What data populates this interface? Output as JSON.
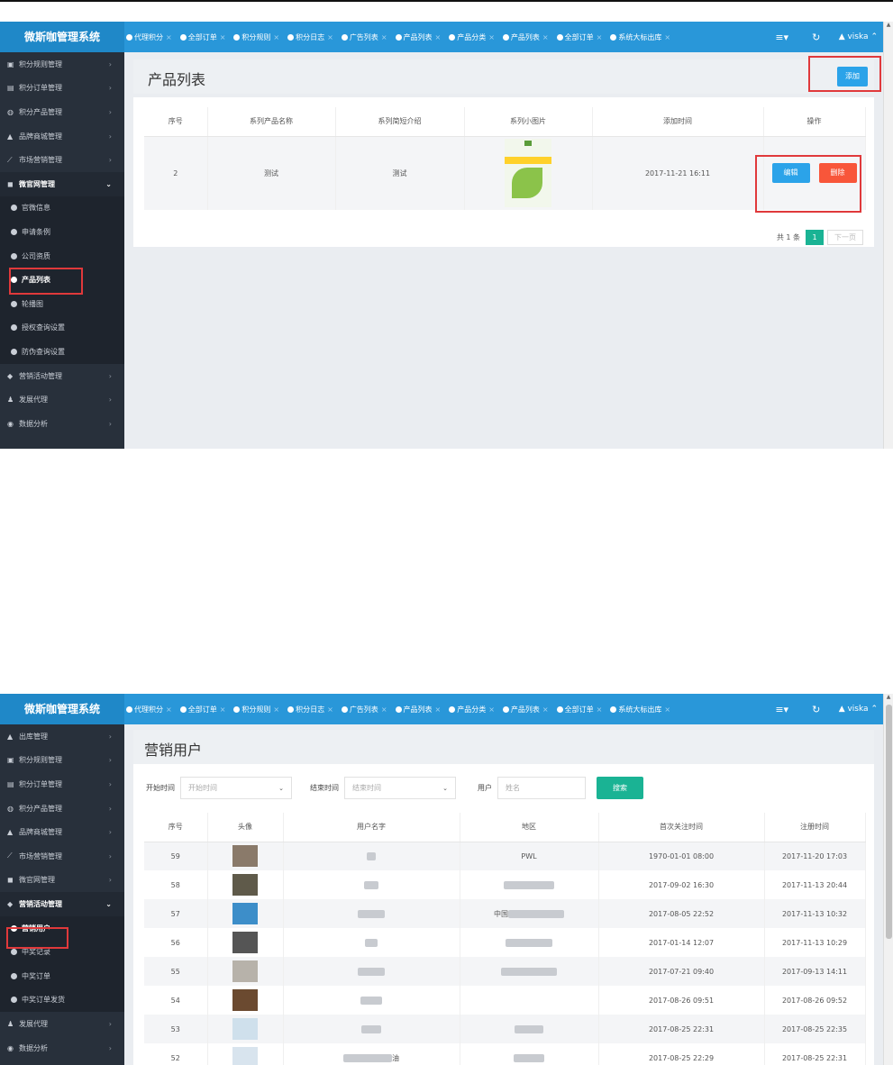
{
  "top": {
    "brand": "微斯咖管理系统",
    "tabs": [
      "代理积分",
      "全部订单",
      "积分规则",
      "积分日志",
      "广告列表",
      "产品列表",
      "产品分类",
      "产品列表",
      "全部订单",
      "系统大标出库"
    ],
    "tab_close": "×",
    "menu_icon": "≡",
    "menu_caret": "▾",
    "refresh_icon": "↻",
    "user_icon": "▲",
    "user": "viska",
    "user_caret": "⌃"
  },
  "shot1": {
    "sidebar": [
      {
        "label": "积分规则管理",
        "icon": "rule-icon",
        "glyph": "▣"
      },
      {
        "label": "积分订单管理",
        "icon": "order-icon",
        "glyph": "▤"
      },
      {
        "label": "积分产品管理",
        "icon": "product-icon",
        "glyph": "◍"
      },
      {
        "label": "品牌商城管理",
        "icon": "mall-icon",
        "glyph": "▲"
      },
      {
        "label": "市场营销管理",
        "icon": "chart-icon",
        "glyph": "⟋"
      },
      {
        "label": "微官网管理",
        "icon": "site-icon",
        "glyph": "◼",
        "open": true
      }
    ],
    "sub": [
      {
        "label": "官微信息"
      },
      {
        "label": "申请条例"
      },
      {
        "label": "公司资质"
      },
      {
        "label": "产品列表",
        "active": true
      },
      {
        "label": "轮播图"
      },
      {
        "label": "授权查询设置"
      },
      {
        "label": "防伪查询设置"
      }
    ],
    "sidebar_after": [
      {
        "label": "营销活动管理",
        "icon": "tag-icon",
        "glyph": "◆"
      },
      {
        "label": "发展代理",
        "icon": "agent-icon",
        "glyph": "♟"
      },
      {
        "label": "数据分析",
        "icon": "analysis-icon",
        "glyph": "◉"
      }
    ],
    "page_title": "产品列表",
    "add_button": "添加",
    "columns": [
      "序号",
      "系列产品名称",
      "系列简短介绍",
      "系列小图片",
      "添加时间",
      "操作"
    ],
    "rows": [
      {
        "id": "2",
        "name": "测试",
        "intro": "测试",
        "image": "product-thumbnail",
        "time": "2017-11-21 16:11"
      }
    ],
    "edit_button": "编辑",
    "delete_button": "删除",
    "pager": {
      "total": "共 1 条",
      "current": "1",
      "next": "下一页"
    }
  },
  "shot2": {
    "sidebar": [
      {
        "label": "出库管理",
        "icon": "warehouse-icon",
        "glyph": "▲"
      },
      {
        "label": "积分规则管理",
        "icon": "rule-icon",
        "glyph": "▣"
      },
      {
        "label": "积分订单管理",
        "icon": "order-icon",
        "glyph": "▤"
      },
      {
        "label": "积分产品管理",
        "icon": "product-icon",
        "glyph": "◍"
      },
      {
        "label": "品牌商城管理",
        "icon": "mall-icon",
        "glyph": "▲"
      },
      {
        "label": "市场营销管理",
        "icon": "chart-icon",
        "glyph": "⟋"
      },
      {
        "label": "微官网管理",
        "icon": "site-icon",
        "glyph": "◼"
      },
      {
        "label": "营销活动管理",
        "icon": "tag-icon",
        "glyph": "◆",
        "open": true
      }
    ],
    "sub": [
      {
        "label": "营销用户",
        "active": true
      },
      {
        "label": "中奖记录"
      },
      {
        "label": "中奖订单"
      },
      {
        "label": "中奖订单发货"
      }
    ],
    "sidebar_after": [
      {
        "label": "发展代理",
        "icon": "agent-icon",
        "glyph": "♟"
      },
      {
        "label": "数据分析",
        "icon": "analysis-icon",
        "glyph": "◉"
      }
    ],
    "page_title": "营销用户",
    "filters": {
      "start_label": "开始时间",
      "start_placeholder": "开始时间",
      "end_label": "结束时间",
      "end_placeholder": "结束时间",
      "user_label": "用户",
      "user_placeholder": "姓名",
      "search_button": "搜索",
      "caret": "⌄"
    },
    "columns": [
      "序号",
      "头像",
      "用户名字",
      "地区",
      "首次关注时间",
      "注册时间"
    ],
    "rows": [
      {
        "id": "59",
        "avatar": "#8a7a6a",
        "name": "",
        "region": "PWL",
        "first": "1970-01-01 08:00",
        "reg": "2017-11-20 17:03"
      },
      {
        "id": "58",
        "avatar": "#5f5a4a",
        "name": "",
        "region": "",
        "first": "2017-09-02 16:30",
        "reg": "2017-11-13 20:44"
      },
      {
        "id": "57",
        "avatar": "#3d8ec9",
        "name": "",
        "region": "中国",
        "first": "2017-08-05 22:52",
        "reg": "2017-11-13 10:32"
      },
      {
        "id": "56",
        "avatar": "#555555",
        "name": "",
        "region": "",
        "first": "2017-01-14 12:07",
        "reg": "2017-11-13 10:29"
      },
      {
        "id": "55",
        "avatar": "#b7b2aa",
        "name": "",
        "region": "",
        "first": "2017-07-21 09:40",
        "reg": "2017-09-13 14:11"
      },
      {
        "id": "54",
        "avatar": "#6b4a30",
        "name": "",
        "region": "",
        "first": "2017-08-26 09:51",
        "reg": "2017-08-26 09:52"
      },
      {
        "id": "53",
        "avatar": "#cfe0ec",
        "name": "",
        "region": "",
        "first": "2017-08-25 22:31",
        "reg": "2017-08-25 22:35"
      },
      {
        "id": "52",
        "avatar": "#d8e4ee",
        "name": "油",
        "region": "",
        "first": "2017-08-25 22:29",
        "reg": "2017-08-25 22:31"
      }
    ]
  }
}
